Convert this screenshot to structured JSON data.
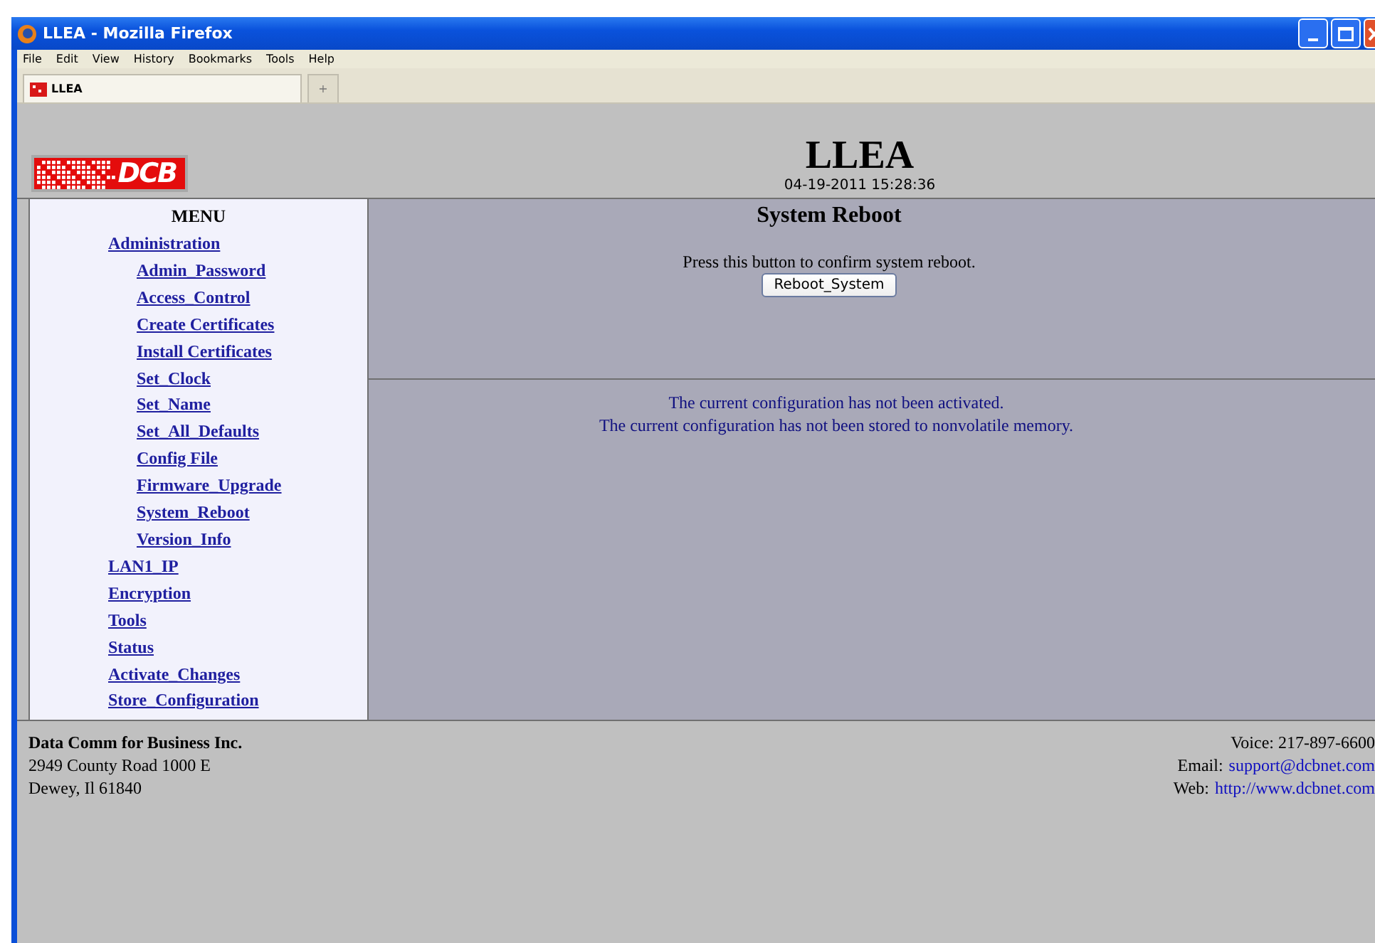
{
  "window": {
    "title": "LLEA - Mozilla Firefox"
  },
  "menu_bar": [
    "File",
    "Edit",
    "View",
    "History",
    "Bookmarks",
    "Tools",
    "Help"
  ],
  "tabs": [
    {
      "label": "LLEA",
      "selected": true
    },
    {
      "label": "+",
      "selected": false
    }
  ],
  "page": {
    "logo": "DCB",
    "title": "LLEA",
    "datetime": "04-19-2011 15:28:36"
  },
  "menu": {
    "heading": "MENU",
    "items": [
      {
        "label": "Administration",
        "children": [
          {
            "label": "Admin_Password"
          },
          {
            "label": "Access_Control"
          },
          {
            "label": "Create Certificates"
          },
          {
            "label": "Install Certificates"
          },
          {
            "label": "Set_Clock"
          },
          {
            "label": "Set_Name"
          },
          {
            "label": "Set_All_Defaults"
          },
          {
            "label": "Config File"
          },
          {
            "label": "Firmware_Upgrade"
          },
          {
            "label": "System_Reboot"
          },
          {
            "label": "Version_Info"
          }
        ]
      },
      {
        "label": "LAN1_IP"
      },
      {
        "label": "Encryption"
      },
      {
        "label": "Tools"
      },
      {
        "label": "Status"
      },
      {
        "label": "Activate_Changes"
      },
      {
        "label": "Store_Configuration"
      }
    ]
  },
  "content": {
    "heading": "System Reboot",
    "prompt": "Press this button to confirm system reboot.",
    "button": "Reboot_System",
    "messages": [
      "The current configuration has not been activated.",
      "The current configuration has not been stored to nonvolatile memory."
    ]
  },
  "footer": {
    "company": "Data Comm for Business Inc.",
    "address": [
      "2949 County Road 1000 E",
      "Dewey, Il 61840"
    ],
    "voice": "Voice: 217-897-6600",
    "email_label": "Email:",
    "email": "support@dcbnet.com",
    "web_label": "Web:",
    "web": "http://www.dcbnet.com"
  }
}
